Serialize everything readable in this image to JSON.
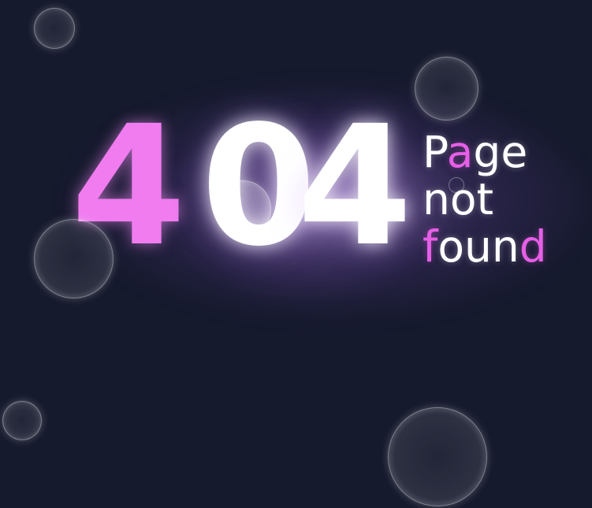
{
  "error_code": {
    "digits": [
      "4",
      "0",
      "4"
    ]
  },
  "message": {
    "line1": {
      "pre": "P",
      "accent": "a",
      "post": "ge"
    },
    "line2": {
      "pre": "not",
      "accent": "",
      "post": ""
    },
    "line3": {
      "pre": "foun",
      "accent": "d",
      "post": ""
    }
  },
  "colors": {
    "background": "#161a2d",
    "accent_pink": "#f07cf0",
    "text_white": "#ffffff"
  }
}
